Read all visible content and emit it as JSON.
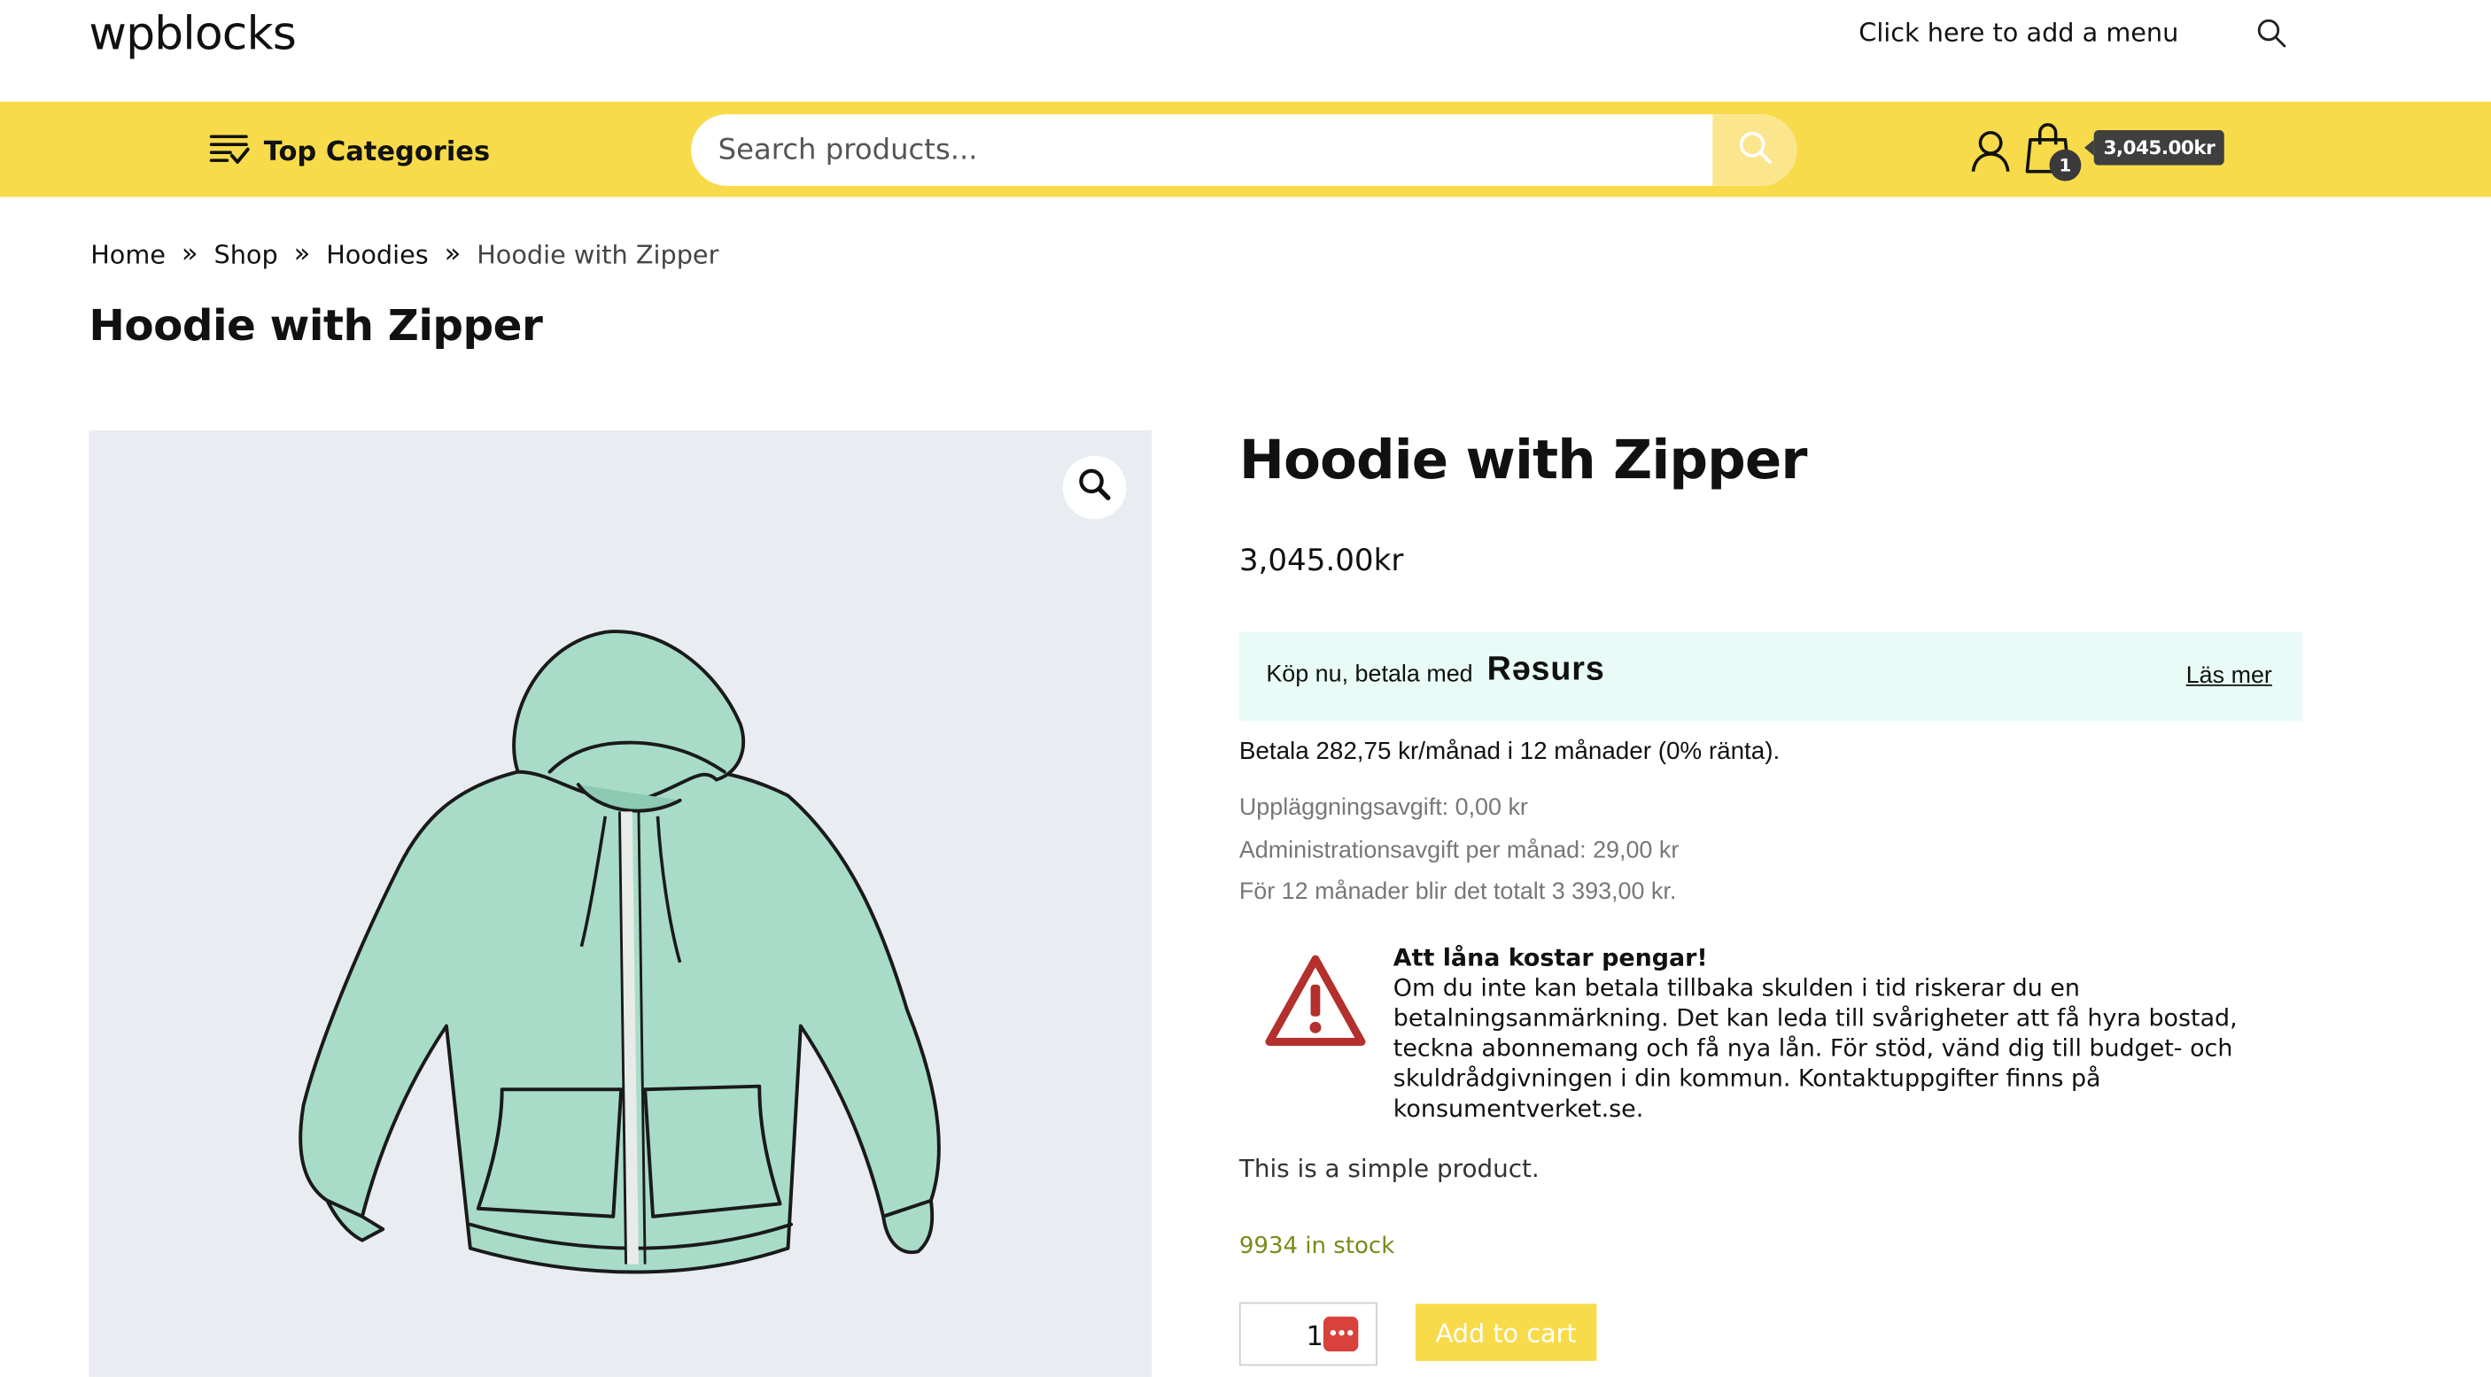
{
  "header": {
    "logo": "wpblocks",
    "menu_link": "Click here to add a menu"
  },
  "navbar": {
    "categories_label": "Top Categories",
    "search_placeholder": "Search products...",
    "cart_count": "1",
    "cart_total": "3,045.00kr"
  },
  "breadcrumb": {
    "items": [
      "Home",
      "Shop",
      "Hoodies",
      "Hoodie with Zipper"
    ]
  },
  "page_title": "Hoodie with Zipper",
  "product": {
    "title": "Hoodie with Zipper",
    "price": "3,045.00",
    "currency": "kr",
    "resurs": {
      "text": "Köp nu, betala med",
      "brand": "Rəsurs",
      "more_link": "Läs mer"
    },
    "installment": "Betala 282,75 kr/månad i 12 månader (0% ränta).",
    "fees": [
      "Uppläggningsavgift: 0,00 kr",
      "Administrationsavgift per månad: 29,00 kr",
      "För 12 månader blir det totalt 3 393,00 kr."
    ],
    "warning_title": "Att låna kostar pengar!",
    "warning_body": "Om du inte kan betala tillbaka skulden i tid riskerar du en betalningsanmärkning. Det kan leda till svårigheter att få hyra bostad, teckna abonnemang och få nya lån. För stöd, vänd dig till budget- och skuldrådgivningen i din kommun. Kontaktuppgifter finns på konsumentverket.se.",
    "description": "This is a simple product.",
    "stock": "9934 in stock",
    "quantity": "1",
    "add_to_cart": "Add to cart"
  },
  "colors": {
    "accent_yellow": "#f8db4a",
    "resurs_bg": "#e8fbf6",
    "warning_red": "#b3302c",
    "stock_green": "#7a8a1a",
    "hoodie_mint": "#a8dcc8"
  }
}
